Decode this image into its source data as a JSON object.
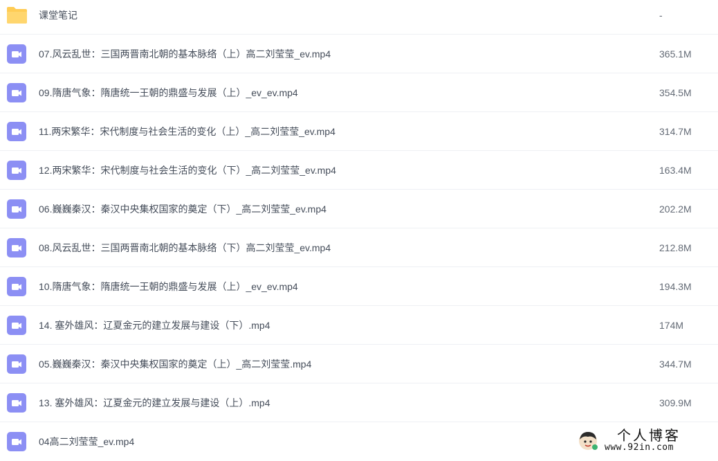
{
  "files": [
    {
      "name": "课堂笔记",
      "size": "-",
      "type": "folder"
    },
    {
      "name": "07.风云乱世：三国两晋南北朝的基本脉络（上）高二刘莹莹_ev.mp4",
      "size": "365.1M",
      "type": "video"
    },
    {
      "name": "09.隋唐气象：隋唐统一王朝的鼎盛与发展（上）_ev_ev.mp4",
      "size": "354.5M",
      "type": "video"
    },
    {
      "name": "11.两宋繁华：宋代制度与社会生活的变化（上）_高二刘莹莹_ev.mp4",
      "size": "314.7M",
      "type": "video"
    },
    {
      "name": "12.两宋繁华：宋代制度与社会生活的变化（下）_高二刘莹莹_ev.mp4",
      "size": "163.4M",
      "type": "video"
    },
    {
      "name": "06.巍巍秦汉：秦汉中央集权国家的奠定（下）_高二刘莹莹_ev.mp4",
      "size": "202.2M",
      "type": "video"
    },
    {
      "name": "08.风云乱世：三国两晋南北朝的基本脉络（下）高二刘莹莹_ev.mp4",
      "size": "212.8M",
      "type": "video"
    },
    {
      "name": "10.隋唐气象：隋唐统一王朝的鼎盛与发展（上）_ev_ev.mp4",
      "size": "194.3M",
      "type": "video"
    },
    {
      "name": "14. 塞外雄风：辽夏金元的建立发展与建设（下）.mp4",
      "size": "174M",
      "type": "video"
    },
    {
      "name": "05.巍巍秦汉：秦汉中央集权国家的奠定（上）_高二刘莹莹.mp4",
      "size": "344.7M",
      "type": "video"
    },
    {
      "name": "13. 塞外雄风：辽夏金元的建立发展与建设（上）.mp4",
      "size": "309.9M",
      "type": "video"
    },
    {
      "name": "04高二刘莹莹_ev.mp4",
      "size": "",
      "type": "video"
    }
  ],
  "watermark": {
    "title": "个人博客",
    "url": "www.92in.com"
  },
  "colors": {
    "folder": "#ffcc55",
    "video": "#8c8ff4",
    "text": "#454d5a",
    "divider": "#eef0f4"
  }
}
